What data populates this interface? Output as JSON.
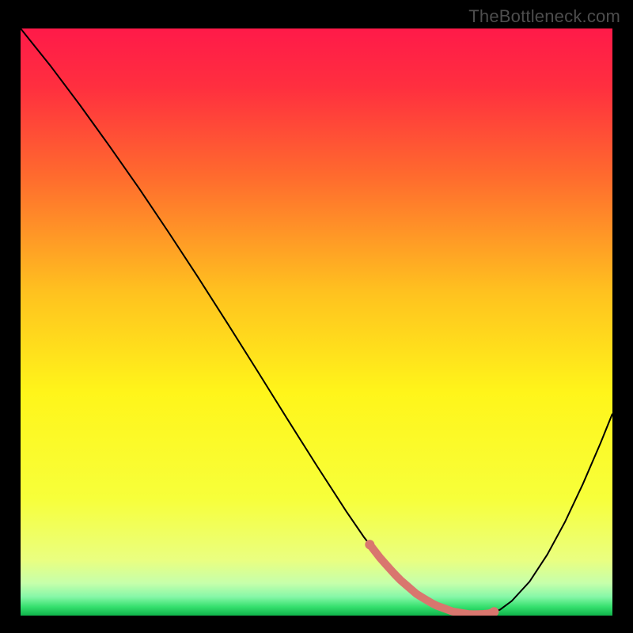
{
  "watermark": "TheBottleneck.com",
  "chart_data": {
    "type": "line",
    "title": "",
    "xlabel": "",
    "ylabel": "",
    "xlim": [
      0,
      100
    ],
    "ylim": [
      0,
      100
    ],
    "background_gradient": {
      "stops": [
        {
          "offset": 0.0,
          "color": "#ff1a49"
        },
        {
          "offset": 0.1,
          "color": "#ff2f3f"
        },
        {
          "offset": 0.25,
          "color": "#ff6a2e"
        },
        {
          "offset": 0.45,
          "color": "#ffc21f"
        },
        {
          "offset": 0.62,
          "color": "#fff51a"
        },
        {
          "offset": 0.8,
          "color": "#f7ff3a"
        },
        {
          "offset": 0.905,
          "color": "#eaff80"
        },
        {
          "offset": 0.945,
          "color": "#c6ffab"
        },
        {
          "offset": 0.968,
          "color": "#86f7a8"
        },
        {
          "offset": 0.985,
          "color": "#35e06e"
        },
        {
          "offset": 1.0,
          "color": "#0fb34a"
        }
      ]
    },
    "series": [
      {
        "name": "bottleneck-curve",
        "color": "#000000",
        "width": 2,
        "x": [
          0,
          5,
          10,
          15,
          20,
          25,
          30,
          35,
          40,
          45,
          50,
          55,
          58,
          61,
          64,
          67,
          70,
          73,
          76,
          79,
          81,
          83,
          86,
          89,
          92,
          95,
          98,
          100
        ],
        "values": [
          100,
          93.7,
          87.0,
          80.0,
          72.8,
          65.3,
          57.6,
          49.7,
          41.7,
          33.6,
          25.6,
          17.8,
          13.4,
          9.5,
          6.2,
          3.6,
          1.8,
          0.7,
          0.2,
          0.3,
          1.0,
          2.5,
          5.8,
          10.4,
          16.0,
          22.4,
          29.4,
          34.4
        ]
      }
    ],
    "highlight_band": {
      "name": "optimal-range",
      "color": "#d9766e",
      "x_start": 59,
      "x_end": 80,
      "y_at_start": 12.4,
      "y_at_end": 0.6,
      "thickness_px": 10
    }
  }
}
